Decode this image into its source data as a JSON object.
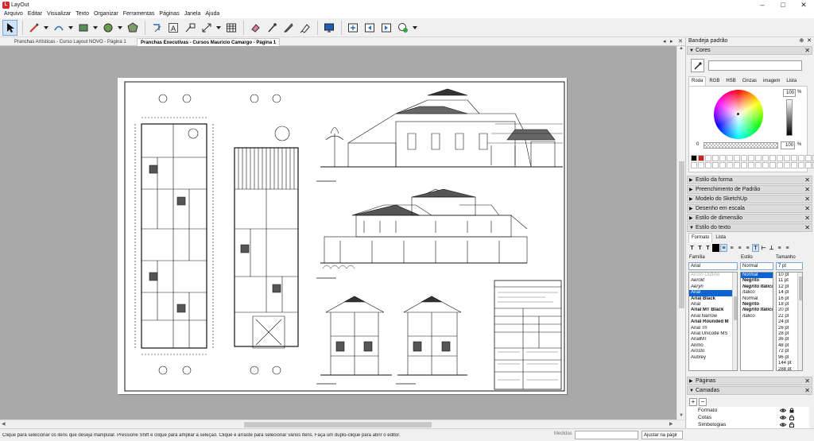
{
  "window": {
    "title": "LayOut"
  },
  "menu": [
    "Arquivo",
    "Editar",
    "Visualizar",
    "Texto",
    "Organizar",
    "Ferramentas",
    "Páginas",
    "Janela",
    "Ajuda"
  ],
  "tabs": [
    {
      "label": "Pranchas Artísticas - Curso Layout  NOVO - Página 1",
      "active": false
    },
    {
      "label": "Pranchas Executivas - Cursos Mauricio Camargo - Página 1",
      "active": true
    }
  ],
  "status": {
    "hint": "Clique para selecionar os itens que deseja manipular. Pressione Shift e clique para ampliar a seleção. Clique e arraste para selecionar vários itens. Faça um duplo-clique para abrir o editor.",
    "measure_label": "Medidas",
    "zoom": "Ajustar na págir"
  },
  "tray": {
    "title": "Bandeja padrão",
    "colors": {
      "header": "Cores",
      "tabs": [
        "Roda",
        "RGB",
        "HSB",
        "Cinzas",
        "imagem",
        "Lista"
      ],
      "value": "100",
      "opacity_label": "0",
      "opacity": "100",
      "percent": "%",
      "swatch_accent": "#cc2222"
    },
    "panels": [
      "Estilo da forma",
      "Preenchimento de Padrão",
      "Modelo do SketchUp",
      "Desenho em escala",
      "Estilo de dimensão",
      "Estilo do texto",
      "Páginas",
      "Camadas"
    ],
    "text_style": {
      "tabs": [
        "Formato",
        "Lista"
      ],
      "family_label": "Família",
      "style_label": "Estilo",
      "size_label": "Tamanho",
      "family_value": "Arial",
      "style_value": "Normal",
      "size_value": "7 pt",
      "families": [
        "Arcon Outline",
        "Aerolit",
        "Aeryn",
        "Arial",
        "Arial Black",
        "Arial",
        "Arial MT Black",
        "Arial Narrow",
        "Arial Rounded M",
        "Arial Th",
        "Arial Unicode MS",
        "ArialMT",
        "Arimo",
        "Arosto",
        "Aubrey"
      ],
      "styles": [
        "Normal",
        "Negrito",
        "Negrito Itálico",
        "Itálico",
        "Normal",
        "Negrito",
        "Negrito Itálico",
        "Itálico"
      ],
      "sizes": [
        "10 pt",
        "11 pt",
        "12 pt",
        "14 pt",
        "16 pt",
        "18 pt",
        "20 pt",
        "22 pt",
        "24 pt",
        "26 pt",
        "28 pt",
        "36 pt",
        "48 pt",
        "72 pt",
        "96 pt",
        "144 pt",
        "288 pt"
      ]
    },
    "layers": [
      "Formato",
      "Cotas",
      "Simbologias"
    ]
  }
}
